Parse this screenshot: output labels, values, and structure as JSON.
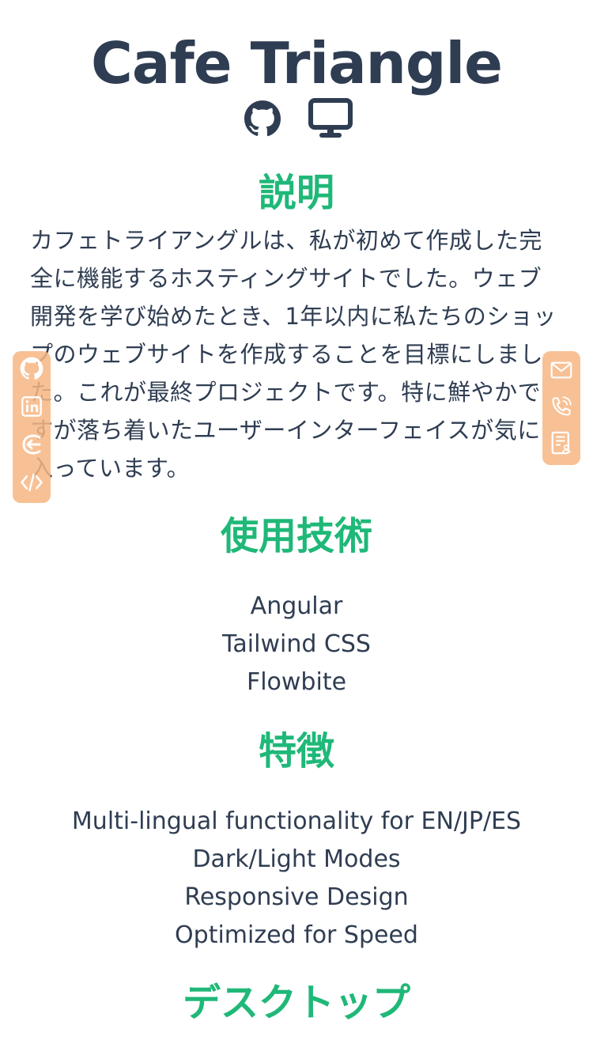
{
  "project": {
    "title": "Cafe Triangle",
    "links": [
      {
        "icon": "github-icon",
        "label": "GitHub"
      },
      {
        "icon": "monitor-icon",
        "label": "Live site"
      }
    ]
  },
  "description": {
    "heading": "説明",
    "text": "カフェトライアングルは、私が初めて作成した完全に機能するホスティングサイトでした。ウェブ開発を学び始めたとき、1年以内に私たちのショップのウェブサイトを作成することを目標にしました。これが最終プロジェクトです。特に鮮やかですが落ち着いたユーザーインターフェイスが気に入っています。"
  },
  "tech": {
    "heading": "使用技術",
    "items": [
      "Angular",
      "Tailwind CSS",
      "Flowbite"
    ]
  },
  "features": {
    "heading": "特徴",
    "items": [
      "Multi-lingual functionality for EN/JP/ES",
      "Dark/Light Modes",
      "Responsive Design",
      "Optimized for Speed"
    ]
  },
  "desktop": {
    "heading": "デスクトップ"
  },
  "side_left": {
    "icons": [
      "github-icon",
      "linkedin-icon",
      "blog-icon",
      "code-icon"
    ]
  },
  "side_right": {
    "icons": [
      "mail-icon",
      "phone-icon",
      "resume-icon"
    ]
  },
  "colors": {
    "heading_accent": "#1fb878",
    "text_primary": "#2f3d52",
    "sidebar_bg": "#f7b682"
  }
}
